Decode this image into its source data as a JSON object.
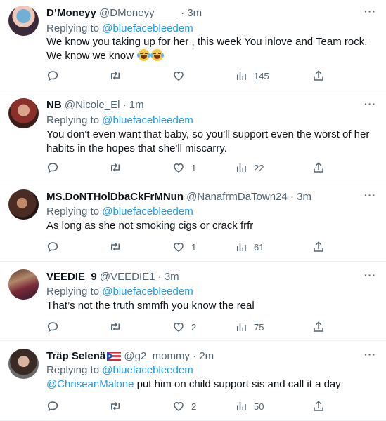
{
  "tweets": [
    {
      "name": "D’Moneyy",
      "handle": "@DMoneyy____",
      "time": "3m",
      "replying_prefix": "Replying to ",
      "replying_to": "@bluefacebleedem",
      "text": "We know you taking up for her , this week You inlove and Team rock. We know we know",
      "emoji": "😂😂",
      "reply_count": "",
      "retweet_count": "",
      "like_count": "",
      "view_count": "145"
    },
    {
      "name": "NB",
      "handle": "@Nicole_El",
      "time": "1m",
      "replying_prefix": "Replying to ",
      "replying_to": "@bluefacebleedem",
      "text": "You don't even want that baby, so you'll support even the worst of her habits in the hopes that she'll miscarry.",
      "reply_count": "",
      "retweet_count": "",
      "like_count": "1",
      "view_count": "22"
    },
    {
      "name": "MS.DoNTHolDbaCkFrMNun",
      "handle": "@NanafrmDaTown24",
      "time": "3m",
      "replying_prefix": "Replying to ",
      "replying_to": "@bluefacebleedem",
      "text": "As long as she not smoking cigs or crack  frfr",
      "reply_count": "",
      "retweet_count": "",
      "like_count": "1",
      "view_count": "61"
    },
    {
      "name": "VEEDIE_9",
      "handle": "@VEEDIE1",
      "time": "3m",
      "replying_prefix": "Replying to ",
      "replying_to": "@bluefacebleedem",
      "text": "That’s not the truth smmfh you know the real",
      "reply_count": "",
      "retweet_count": "",
      "like_count": "2",
      "view_count": "75"
    },
    {
      "name": "Träp Selenä",
      "handle": "@g2_mommy",
      "time": "2m",
      "replying_prefix": "Replying to ",
      "replying_to": "@bluefacebleedem",
      "mention": "@ChriseanMalone",
      "text": " put him on child support sis and call it a day",
      "reply_count": "",
      "retweet_count": "",
      "like_count": "2",
      "view_count": "50"
    }
  ],
  "separator": "·",
  "more_label": "···",
  "colors": {
    "text": "#0f1419",
    "muted": "#536471",
    "accent": "#1d9bf0",
    "divider": "#eff3f4"
  },
  "icons": [
    "reply-icon",
    "retweet-icon",
    "like-icon",
    "views-icon",
    "share-icon",
    "more-icon"
  ]
}
